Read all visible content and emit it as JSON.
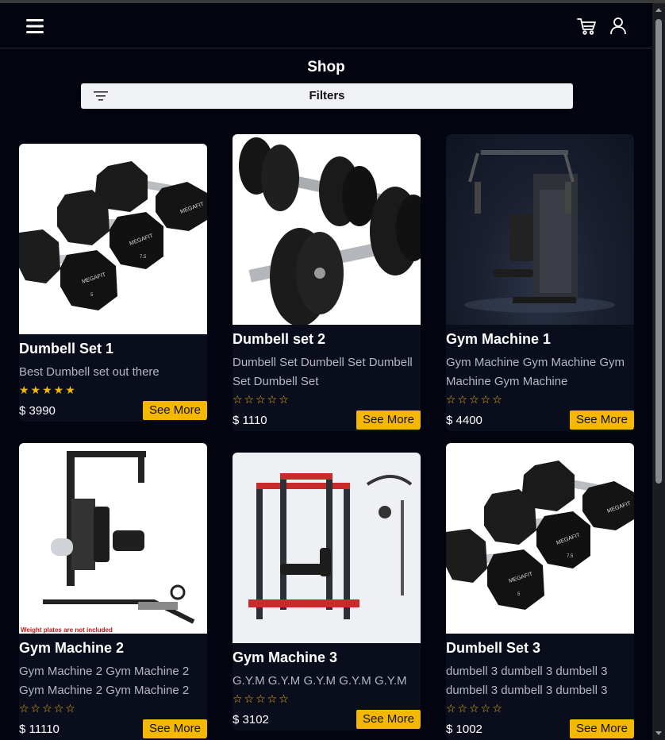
{
  "nav": {
    "menu_icon": "hamburger-menu-icon",
    "cart_icon": "shopping-cart-icon",
    "user_icon": "user-account-icon"
  },
  "page": {
    "title": "Shop"
  },
  "filters": {
    "label": "Filters",
    "icon": "filter-lines-icon"
  },
  "colors": {
    "background": "#02040f",
    "accent": "#f5b800",
    "filter_bar": "#f0f1f4"
  },
  "products": [
    {
      "title": "Dumbell Set 1",
      "desc": "Best Dumbell set out there",
      "stars": "★★★★★",
      "rating": 5,
      "price": "$ 3990",
      "button": "See More"
    },
    {
      "title": "Dumbell set 2",
      "desc": "Dumbell Set Dumbell Set Dumbell Set Dumbell Set",
      "stars": "☆☆☆☆☆",
      "rating": 0,
      "price": "$ 1110",
      "button": "See More"
    },
    {
      "title": "Gym Machine 1",
      "desc": "Gym Machine Gym Machine Gym Machine Gym Machine",
      "stars": "☆☆☆☆☆",
      "rating": 0,
      "price": "$ 4400",
      "button": "See More"
    },
    {
      "title": "Gym Machine 2",
      "desc": "Gym Machine 2 Gym Machine 2 Gym Machine 2 Gym Machine 2",
      "stars": "☆☆☆☆☆",
      "rating": 0,
      "price": "$ 11110",
      "button": "See More",
      "image_caption": "Weight plates are not included"
    },
    {
      "title": "Gym Machine 3",
      "desc": "G.Y.M G.Y.M G.Y.M G.Y.M G.Y.M",
      "stars": "☆☆☆☆☆",
      "rating": 0,
      "price": "$ 3102",
      "button": "See More"
    },
    {
      "title": "Dumbell Set 3",
      "desc": "dumbell 3 dumbell 3 dumbell 3 dumbell 3 dumbell 3 dumbell 3",
      "stars": "☆☆☆☆☆",
      "rating": 0,
      "price": "$ 1002",
      "button": "See More"
    }
  ]
}
